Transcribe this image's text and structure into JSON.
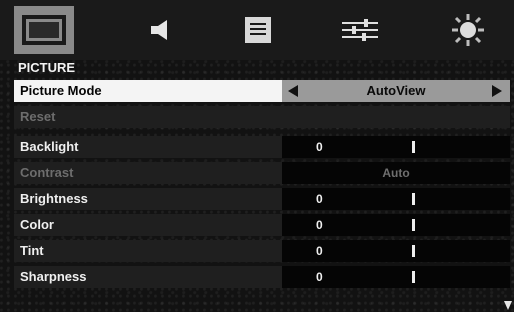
{
  "icons": [
    {
      "name": "picture-icon",
      "active": true
    },
    {
      "name": "audio-icon",
      "active": false
    },
    {
      "name": "menu-list-icon",
      "active": false
    },
    {
      "name": "settings-sliders-icon",
      "active": false
    },
    {
      "name": "brightness-sun-icon",
      "active": false
    }
  ],
  "section_title": "PICTURE",
  "menu": {
    "picture_mode": {
      "label": "Picture Mode",
      "value": "AutoView"
    },
    "reset": {
      "label": "Reset"
    },
    "backlight": {
      "label": "Backlight",
      "value": "0"
    },
    "contrast": {
      "label": "Contrast",
      "value": "Auto"
    },
    "brightness": {
      "label": "Brightness",
      "value": "0"
    },
    "color": {
      "label": "Color",
      "value": "0"
    },
    "tint": {
      "label": "Tint",
      "value": "0"
    },
    "sharpness": {
      "label": "Sharpness",
      "value": "0"
    }
  },
  "colors": {
    "selected_label_bg": "#f4f4f4",
    "selected_value_bg": "#9a9a9a",
    "row_bg": "#1f1f1f",
    "value_bg": "#050505",
    "disabled_text": "#6d6d6d"
  }
}
